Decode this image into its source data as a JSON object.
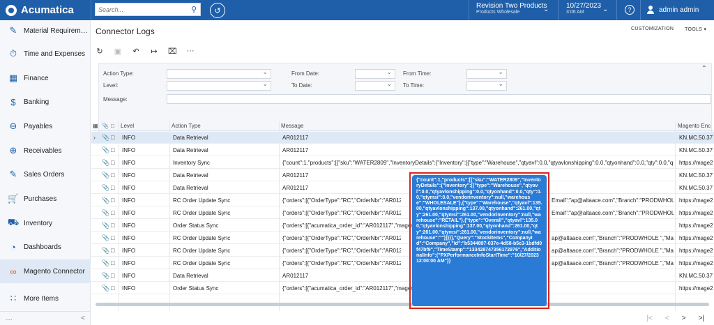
{
  "app": {
    "name": "Acumatica"
  },
  "topbar": {
    "search_placeholder": "Search...",
    "company": "Revision Two Products",
    "branch": "Products Wholesale",
    "date": "10/27/2023",
    "time": "3:06 AM",
    "user": "admin admin"
  },
  "sidebar": {
    "items": [
      {
        "label": "Material Requirem…",
        "icon": "material-icon"
      },
      {
        "label": "Time and Expenses",
        "icon": "clock-icon"
      },
      {
        "label": "Finance",
        "icon": "calculator-icon"
      },
      {
        "label": "Banking",
        "icon": "dollar-icon"
      },
      {
        "label": "Payables",
        "icon": "minus-circle-icon"
      },
      {
        "label": "Receivables",
        "icon": "plus-circle-icon"
      },
      {
        "label": "Sales Orders",
        "icon": "edit-icon"
      },
      {
        "label": "Purchases",
        "icon": "cart-icon"
      },
      {
        "label": "Inventory",
        "icon": "truck-icon"
      },
      {
        "label": "Dashboards",
        "icon": "gauge-icon"
      },
      {
        "label": "Magento Connector",
        "icon": "magento-icon"
      },
      {
        "label": "More Items",
        "icon": "grid-icon"
      }
    ],
    "collapse": "<"
  },
  "page": {
    "title": "Connector Logs",
    "customization": "CUSTOMIZATION",
    "tools": "TOOLS ▾"
  },
  "filters": {
    "action_type": "Action Type:",
    "level": "Level:",
    "message": "Message:",
    "from_date": "From Date:",
    "to_date": "To Date:",
    "from_time": "From Time:",
    "to_time": "To Time:"
  },
  "grid": {
    "headers": {
      "level": "Level",
      "action_type": "Action Type",
      "message": "Message",
      "magento": "Magento Enc"
    },
    "rows": [
      {
        "level": "INFO",
        "action": "Data Retrieval",
        "message": "AR012117",
        "magento": "KN.MC.50.37"
      },
      {
        "level": "INFO",
        "action": "Data Retrieval",
        "message": "AR012117",
        "magento": "KN.MC.50.37"
      },
      {
        "level": "INFO",
        "action": "Inventory Sync",
        "message": "{\"count\":1,\"products\":[{\"sku\":\"WATER2809\",\"InventoryDetails\":{\"Inventory\":[{\"type\":\"Warehouse\",\"qtyavl\":0.0,\"qtyavlonshipping\":0.0,\"qtyonhand\":0.0,\"qty\":0.0,\"qtym…",
        "magento": "https://mage2"
      },
      {
        "level": "INFO",
        "action": "Data Retrieval",
        "message": "AR012117",
        "magento": "KN.MC.50.37"
      },
      {
        "level": "INFO",
        "action": "Data Retrieval",
        "message": "AR012117",
        "magento": "KN.MC.50.37"
      },
      {
        "level": "INFO",
        "action": "RC Order Update Sync",
        "message": "{\"orders\":[{\"OrderType\":\"RC\",\"OrderNbr\":\"AR012117\",",
        "tail": "Email\":\"ap@altaace.com\",\"Branch\":\"PRODWHOLE …",
        "magento": "https://mage2"
      },
      {
        "level": "INFO",
        "action": "RC Order Update Sync",
        "message": "{\"orders\":[{\"OrderType\":\"RC\",\"OrderNbr\":\"AR012117\",",
        "tail": "Email\":\"ap@altaace.com\",\"Branch\":\"PRODWHOLE …",
        "magento": "https://mage2"
      },
      {
        "level": "INFO",
        "action": "Order Status Sync",
        "message": "{\"orders\":[{\"acumatica_order_id\":\"AR012117\",\"magen",
        "tail": "",
        "magento": "https://mage2"
      },
      {
        "level": "INFO",
        "action": "RC Order Update Sync",
        "message": "{\"orders\":[{\"OrderType\":\"RC\",\"OrderNbr\":\"AR012117\",",
        "tail": "ap@altaace.com\",\"Branch\":\"PRODWHOLE \",\"Ma…",
        "magento": "https://mage2"
      },
      {
        "level": "INFO",
        "action": "RC Order Update Sync",
        "message": "{\"orders\":[{\"OrderType\":\"RC\",\"OrderNbr\":\"AR012117\",",
        "tail": "ap@altaace.com\",\"Branch\":\"PRODWHOLE \",\"Ma…",
        "magento": "https://mage2"
      },
      {
        "level": "INFO",
        "action": "RC Order Update Sync",
        "message": "{\"orders\":[{\"OrderType\":\"RC\",\"OrderNbr\":\"AR012117\",",
        "tail": "ap@altaace.com\",\"Branch\":\"PRODWHOLE \",\"Ma…",
        "magento": "https://mage2"
      },
      {
        "level": "INFO",
        "action": "Data Retrieval",
        "message": "AR012117",
        "magento": "KN.MC.50.37"
      },
      {
        "level": "INFO",
        "action": "Order Status Sync",
        "message": "{\"orders\":[{\"acumatica_order_id\":\"AR012117\",\"magen",
        "tail": "",
        "magento": "https://mage2"
      }
    ]
  },
  "tooltip": {
    "text": "{\"count\":1,\"products\":[{\"sku\":\"WATER2809\",\"InventoryDetails\":{\"Inventory\":[{\"type\":\"Warehouse\",\"qtyavl\":0.0,\"qtyavlonshipping\":0.0,\"qtyonhand\":0.0,\"qty\":0.0,\"qtymsi\":0.0,\"vendorinventory\":null,\"warehouse\":\"WHOLESALE\"},{\"type\":\"Warehouse\",\"qtyavl\":135.00,\"qtyavlonshipping\":137.00,\"qtyonhand\":261.00,\"qty\":261.00,\"qtymsi\":261.00,\"vendorinventory\":null,\"warehouse\":\"RETAIL\"},{\"type\":\"Overall\",\"qtyavl\":135.00,\"qtyavlonshipping\":137.00,\"qtyonhand\":261.00,\"qty\":261.00,\"qtymsi\":261.00,\"vendorinventory\":null,\"warehouse\":\"\"}]}}],\"Query\":\"StockItems\",\"CompanyId\":\"Company\",\"Id\":\"b5344897-037e-4d58-b5c3-1bdfd0f47bf9\",\"TimeStamp\":\"133428747356172976\",\"AdditionalInfo\":{\"PXPerformanceInfoStartTime\":\"10/27/2023 12:00:00 AM\"}}"
  },
  "colors": {
    "brand": "#1f5fa9",
    "tooltip": "#2a7bd6",
    "highlight": "#d9251c"
  }
}
